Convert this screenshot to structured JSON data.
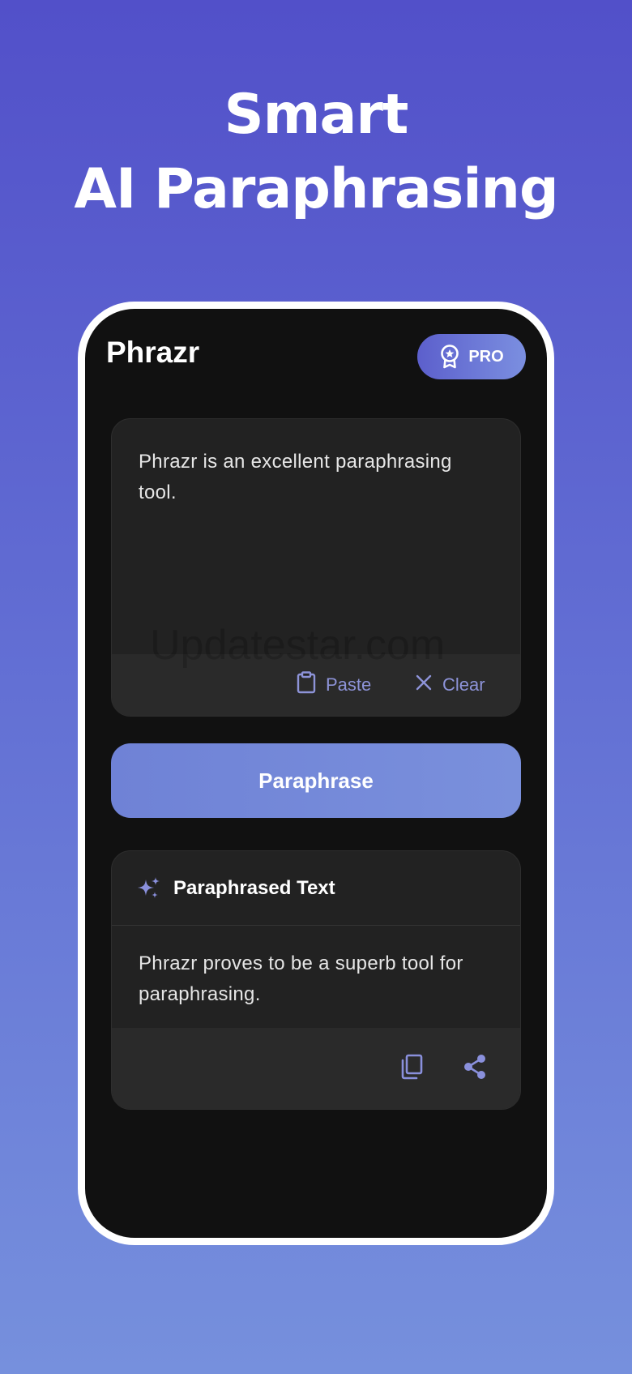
{
  "headline": {
    "line1": "Smart",
    "line2": "AI Paraphrasing"
  },
  "app": {
    "title": "Phrazr",
    "pro_label": "PRO"
  },
  "input": {
    "text": "Phrazr is an excellent paraphrasing tool.",
    "paste_label": "Paste",
    "clear_label": "Clear"
  },
  "actions": {
    "paraphrase_label": "Paraphrase"
  },
  "output": {
    "title": "Paraphrased Text",
    "text": "Phrazr proves to be a superb tool for paraphrasing."
  },
  "watermark": "Updatestar.com",
  "icons": {
    "pro": "badge-star-icon",
    "paste": "clipboard-icon",
    "clear": "close-icon",
    "output": "sparkle-icon",
    "copy": "copy-icon",
    "share": "share-icon"
  },
  "colors": {
    "background_top": "#5250c9",
    "background_bottom": "#7690dd",
    "accent": "#7a8cdc",
    "action_text": "#8d93d8",
    "card": "#222222",
    "screen": "#111111"
  }
}
